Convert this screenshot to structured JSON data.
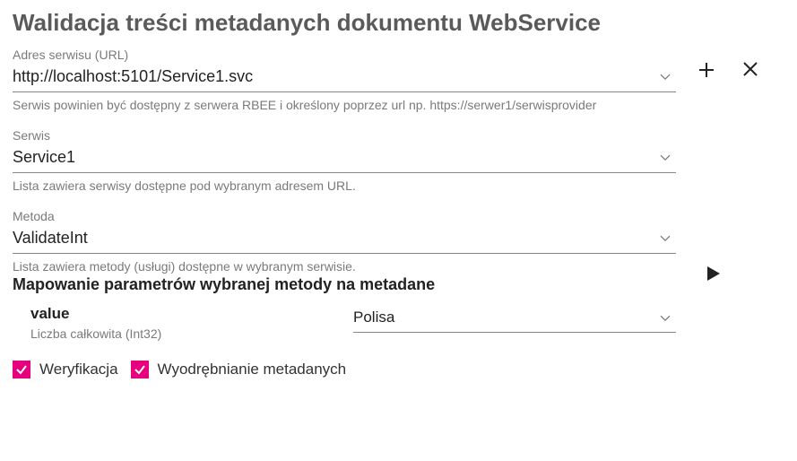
{
  "heading": "Walidacja treści metadanych dokumentu WebService",
  "url_field": {
    "label": "Adres serwisu (URL)",
    "value": "http://localhost:5101/Service1.svc",
    "helper": "Serwis powinien być dostępny z serwera RBEE i określony poprzez url np. https://serwer1/serwisprovider"
  },
  "service_field": {
    "label": "Serwis",
    "value": "Service1",
    "helper": "Lista zawiera serwisy dostępne pod wybranym adresem URL."
  },
  "method_field": {
    "label": "Metoda",
    "value": "ValidateInt",
    "helper": "Lista zawiera metody (usługi) dostępne w wybranym serwisie."
  },
  "mapping": {
    "title": "Mapowanie parametrów wybranej metody na metadane",
    "param_name": "value",
    "param_type": "Liczba całkowita (Int32)",
    "mapped_value": "Polisa"
  },
  "checkboxes": {
    "verify_label": "Weryfikacja",
    "verify_checked": true,
    "extract_label": "Wyodrębnianie metadanych",
    "extract_checked": true
  },
  "colors": {
    "accent": "#e6007e"
  }
}
